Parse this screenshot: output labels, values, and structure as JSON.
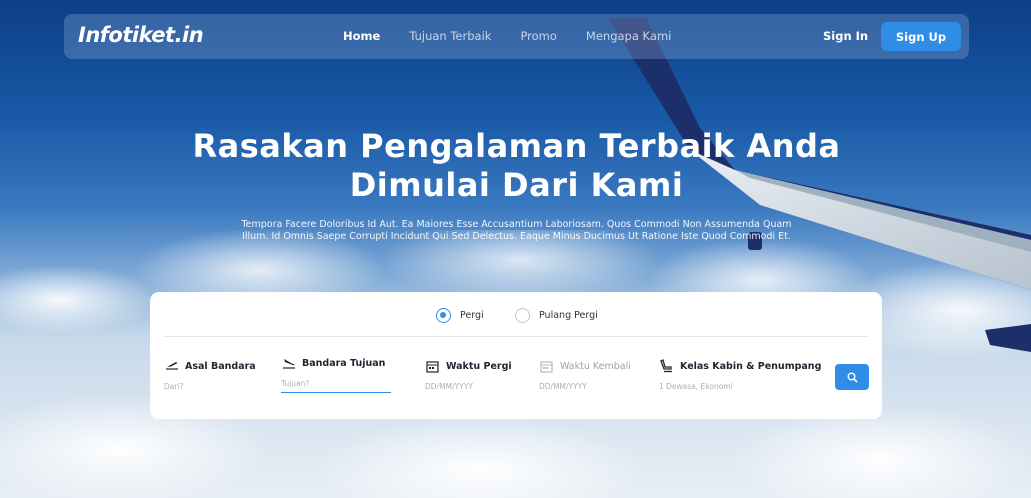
{
  "brand": {
    "logo": "Infotiket.in"
  },
  "nav": {
    "links": [
      "Home",
      "Tujuan Terbaik",
      "Promo",
      "Mengapa Kami"
    ],
    "signin": "Sign In",
    "signup": "Sign Up"
  },
  "hero": {
    "title_line1": "Rasakan Pengalaman Terbaik Anda",
    "title_line2": "Dimulai Dari Kami",
    "subtitle_line1": "Tempora Facere Doloribus Id Aut. Ea Maiores Esse Accusantium Laboriosam. Quos Commodi Non Assumenda Quam",
    "subtitle_line2": "Illum. Id Omnis Saepe Corrupti Incidunt Qui Sed Delectus. Eaque Minus Ducimus Ut Ratione Iste Quod Commodi Et."
  },
  "search": {
    "trip_types": [
      {
        "label": "Pergi",
        "selected": true
      },
      {
        "label": "Pulang Pergi",
        "selected": false
      }
    ],
    "fields": {
      "origin": {
        "label": "Asal Bandara",
        "placeholder": "Dari?",
        "icon": "plane-takeoff-icon"
      },
      "destination": {
        "label": "Bandara Tujuan",
        "placeholder": "Tujuan?",
        "icon": "plane-landing-icon"
      },
      "depart": {
        "label": "Waktu Pergi",
        "placeholder": "DD/MM/YYYY",
        "icon": "calendar-icon"
      },
      "return": {
        "label": "Waktu Kembali",
        "placeholder": "DD/MM/YYYY",
        "icon": "calendar-icon"
      },
      "cabin": {
        "label": "Kelas Kabin & Penumpang",
        "value": "1 Dewasa, Ekonomi",
        "icon": "seat-icon"
      }
    },
    "search_icon": "search-icon"
  },
  "colors": {
    "accent": "#2f8de8",
    "navy": "#1e2430"
  }
}
